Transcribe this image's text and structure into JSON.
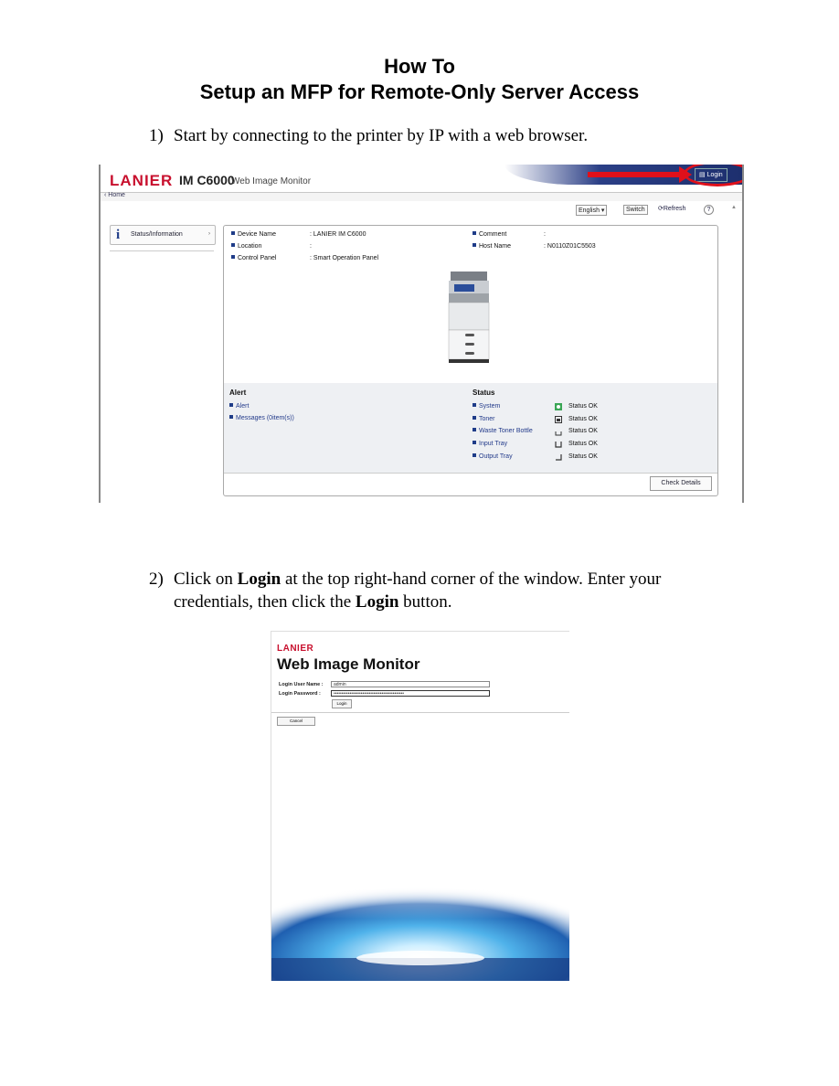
{
  "doc": {
    "title_line1": "How To",
    "title_line2": "Setup an MFP for Remote-Only Server Access",
    "step1_num": "1)",
    "step1_text": "Start by connecting to the printer by IP with a web browser.",
    "step2_num": "2)",
    "step2_text_a": "Click on ",
    "step2_bold_a": "Login",
    "step2_text_b": " at the top right-hand corner of the window.  Enter your",
    "step2_text_c": "credentials, then click the ",
    "step2_bold_b": "Login",
    "step2_text_d": " button."
  },
  "wim1": {
    "brand": "LANIER",
    "model": "IM C6000",
    "app": "Web Image Monitor",
    "login": "Login",
    "home": "Home",
    "language": "English",
    "switch": "Switch",
    "refresh": "Refresh",
    "help": "?",
    "side_item": "Status/Information",
    "device_name_label": "Device Name",
    "device_name_value": ": LANIER IM C6000",
    "location_label": "Location",
    "location_value": ":",
    "control_panel_label": "Control Panel",
    "control_panel_value": ": Smart Operation Panel",
    "comment_label": "Comment",
    "comment_value": ":",
    "host_label": "Host Name",
    "host_value": ": N0110Z01C5503",
    "alert_title": "Alert",
    "alert_link": "Alert",
    "messages_link": "Messages (0item(s))",
    "status_title": "Status",
    "status_rows": [
      {
        "name": "System",
        "value": "Status OK"
      },
      {
        "name": "Toner",
        "value": "Status OK"
      },
      {
        "name": "Waste Toner Bottle",
        "value": "Status OK"
      },
      {
        "name": "Input Tray",
        "value": "Status OK"
      },
      {
        "name": "Output Tray",
        "value": "Status OK"
      }
    ],
    "check_details": "Check Details",
    "accent_color": "#e0101a"
  },
  "wim2": {
    "brand": "LANIER",
    "app": "Web Image Monitor",
    "user_label": "Login User Name :",
    "user_value": "admin",
    "pass_label": "Login Password :",
    "pass_value": "••••••••••••••••••••••••••••••••••••••••••••",
    "login_btn": "Login",
    "cancel_btn": "Cancel"
  }
}
